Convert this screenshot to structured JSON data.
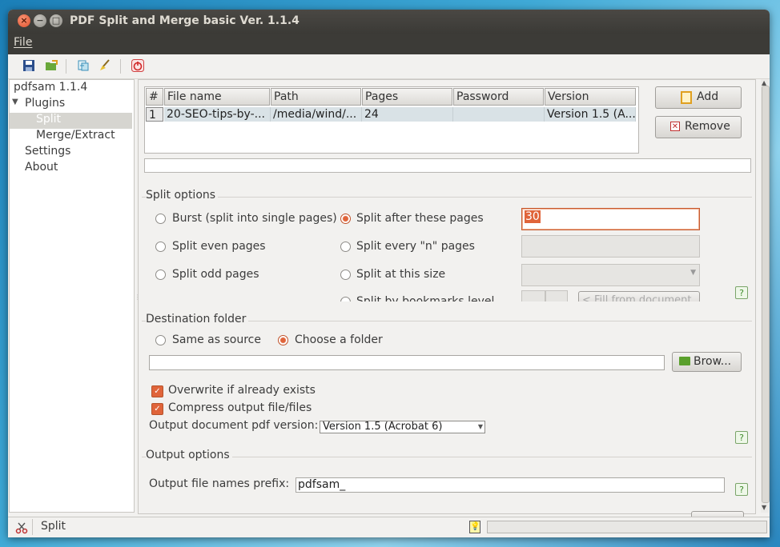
{
  "window": {
    "title": "PDF Split and Merge basic Ver. 1.1.4"
  },
  "menubar": {
    "file": "File"
  },
  "toolbar": {
    "icons": [
      "save-icon",
      "open-icon",
      "export-icon",
      "clear-icon",
      "exit-icon"
    ]
  },
  "tree": {
    "root": "pdfsam 1.1.4",
    "plugins": "Plugins",
    "split": "Split",
    "merge": "Merge/Extract",
    "settings": "Settings",
    "about": "About"
  },
  "table": {
    "headers": [
      "#",
      "File name",
      "Path",
      "Pages",
      "Password",
      "Version"
    ],
    "rows": [
      {
        "num": "1",
        "file": "20-SEO-tips-by-...",
        "path": "/media/wind/...",
        "pages": "24",
        "password": "",
        "version": "Version 1.5 (A..."
      }
    ]
  },
  "buttons": {
    "add": "Add",
    "remove": "Remove",
    "browse": "Brow..."
  },
  "split_options": {
    "title": "Split options",
    "burst": "Burst (split into single pages)",
    "even": "Split even pages",
    "odd": "Split odd pages",
    "after": "Split after these pages",
    "every_n": "Split every \"n\" pages",
    "size": "Split at this size",
    "bookmarks": "Split by bookmarks level",
    "after_value": "30",
    "fill_from_doc": "< Fill from document"
  },
  "destination": {
    "title": "Destination folder",
    "same_as_source": "Same as source",
    "choose_folder": "Choose a folder",
    "path_value": "",
    "overwrite": "Overwrite if already exists",
    "compress": "Compress output file/files",
    "pdf_version_label": "Output document pdf version:",
    "pdf_version_value": "Version 1.5 (Acrobat 6)"
  },
  "output": {
    "title": "Output options",
    "prefix_label": "Output file names prefix:",
    "prefix_value": "pdfsam_"
  },
  "status": {
    "plugin": "Split"
  },
  "colors": {
    "accent": "#e0643a",
    "titlebar": "#3c3b37"
  }
}
